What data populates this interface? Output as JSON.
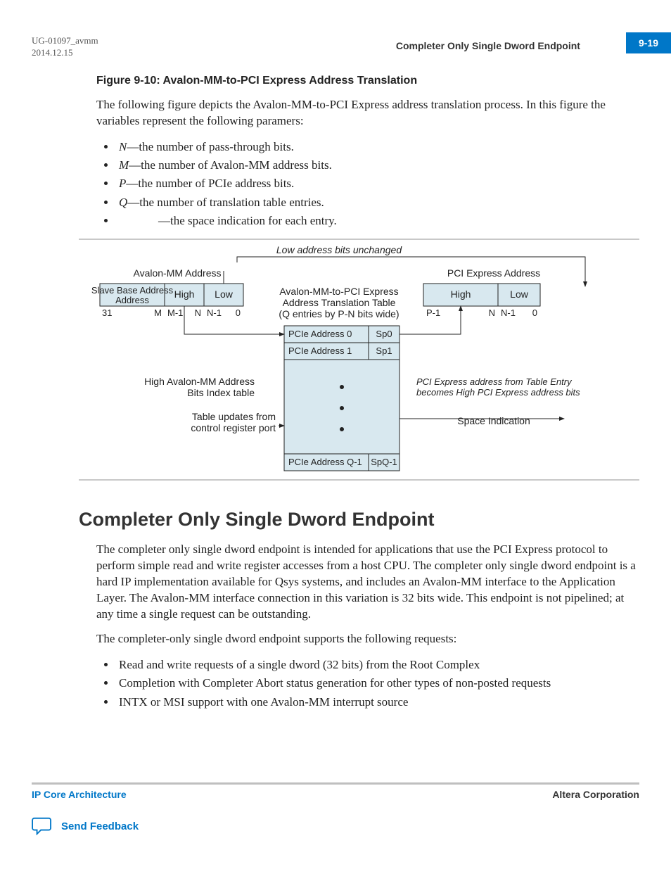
{
  "header": {
    "doc_id": "UG-01097_avmm",
    "date": "2014.12.15",
    "section_title": "Completer Only Single Dword Endpoint",
    "page_num": "9-19"
  },
  "figure_caption": "Figure 9-10: Avalon-MM-to-PCI Express Address Translation",
  "intro_para": "The following figure depicts the Avalon-MM-to-PCI Express address translation process. In this figure the variables represent the following paramers:",
  "vars": [
    {
      "sym": "N",
      "desc": "—the number of pass-through bits."
    },
    {
      "sym": "M",
      "desc": "—the number of Avalon-MM address bits."
    },
    {
      "sym": "P",
      "desc": "—the number of PCIe address bits."
    },
    {
      "sym": "Q",
      "desc": "—the number of translation table entries."
    },
    {
      "sym": "",
      "desc": "—the space indication for each entry."
    }
  ],
  "diagram": {
    "top_caption": "Low address bits unchanged",
    "left_title": "Avalon-MM Address",
    "right_title": "PCI Express Address",
    "left_cells": [
      "Slave Base Address",
      "High",
      "Low"
    ],
    "left_ticks": [
      "31",
      "M",
      "M-1",
      "N",
      "N-1",
      "0"
    ],
    "right_cells": [
      "High",
      "Low"
    ],
    "right_ticks": [
      "P-1",
      "N",
      "N-1",
      "0"
    ],
    "table_title1": "Avalon-MM-to-PCI Express",
    "table_title2": "Address Translation Table",
    "table_title3": "(Q entries by P-N bits wide)",
    "rows": [
      {
        "addr": "PCIe Address 0",
        "sp": "Sp0"
      },
      {
        "addr": "PCIe Address 1",
        "sp": "Sp1"
      }
    ],
    "last_row": {
      "addr": "PCIe Address Q-1",
      "sp": "SpQ-1"
    },
    "left_note1a": "High Avalon-MM Address",
    "left_note1b": "Bits Index table",
    "left_note2a": "Table updates from",
    "left_note2b": "control register port",
    "right_note1a": "PCI Express address from Table Entry",
    "right_note1b": "becomes High PCI Express address bits",
    "right_note2": "Space Indication"
  },
  "section_heading": "Completer Only Single Dword Endpoint",
  "para1": "The completer only single dword endpoint is intended for applications that use the PCI Express protocol to perform simple read and write register accesses from a host CPU. The completer only single dword endpoint is a hard IP implementation available for Qsys systems, and includes an Avalon‑MM interface to the Application Layer. The Avalon‑MM interface connection in this variation is 32 bits wide. This endpoint is not pipelined; at any time a single request can be outstanding.",
  "para2": "The completer-only single dword endpoint supports the following requests:",
  "bullets2": [
    "Read and write requests of a single dword (32 bits) from the Root Complex",
    "Completion with Completer Abort status generation for other types of non‑posted requests",
    "INTX or MSI support with one Avalon‑MM interrupt source"
  ],
  "footer": {
    "left": "IP Core Architecture",
    "right": "Altera Corporation",
    "feedback": "Send Feedback"
  }
}
